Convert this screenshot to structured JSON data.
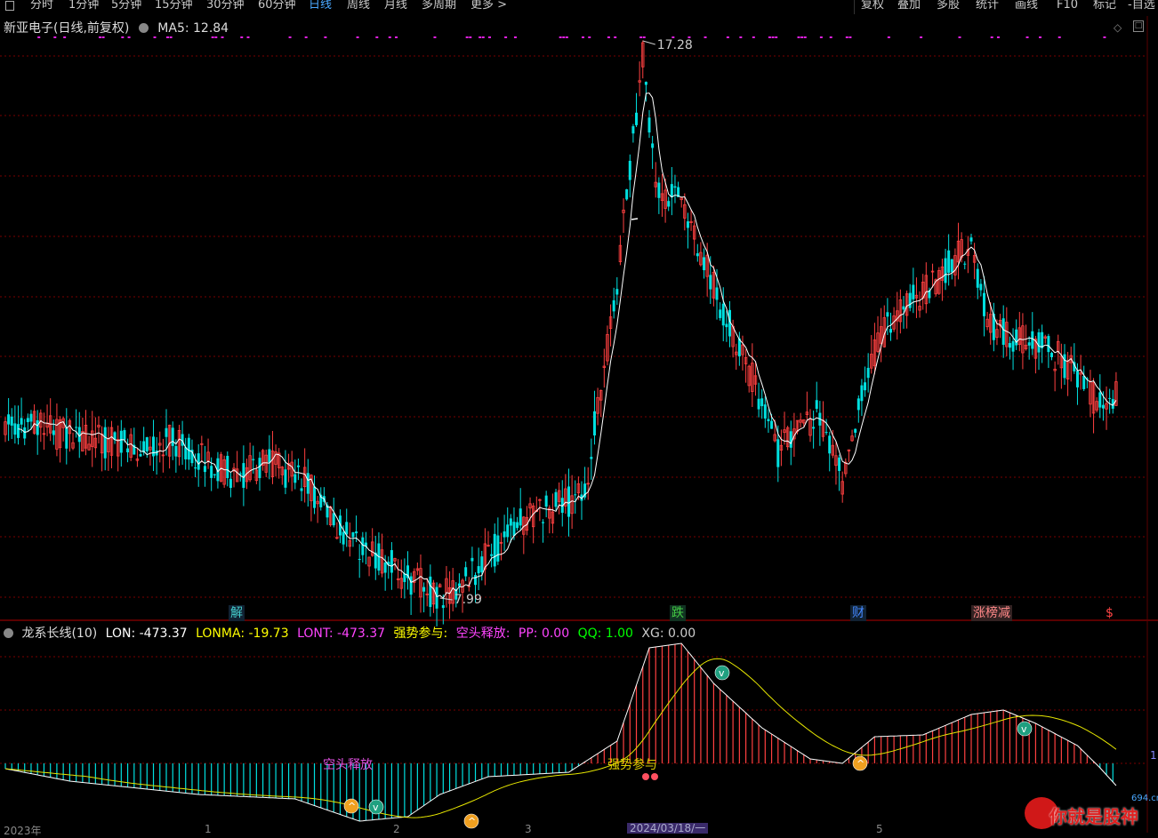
{
  "toolbar": {
    "left_tabs": [
      "分时",
      "1分钟",
      "5分钟",
      "15分钟",
      "30分钟",
      "60分钟",
      "日线",
      "周线",
      "月线",
      "多周期",
      "更多 >"
    ],
    "active_tab": "日线",
    "right_tabs": [
      "复权",
      "叠加",
      "多股",
      "统计",
      "画线",
      "F10",
      "标记",
      "-自选"
    ]
  },
  "stock": {
    "title": "新亚电子(日线,前复权)",
    "ma_label": "MA5: 12.84",
    "high_label": "17.28",
    "low_label": "7.99"
  },
  "events": [
    {
      "label": "解",
      "color": "#4cc",
      "bg": "#123"
    },
    {
      "label": "跌",
      "color": "#4c4",
      "bg": "#132"
    },
    {
      "label": "财",
      "color": "#48f",
      "bg": "#123"
    },
    {
      "label": "涨榜减",
      "color": "#f88",
      "bg": "#322"
    },
    {
      "label": "$",
      "color": "#f44",
      "bg": "transparent"
    }
  ],
  "indicator": {
    "name": "龙系长线(10)",
    "lon": "LON: -473.37",
    "lonma": "LONMA: -19.73",
    "lont": "LONT: -473.37",
    "strong_label": "强势参与:",
    "short_label": "空头释放:",
    "pp": "PP: 0.00",
    "qq": "QQ: 1.00",
    "xg": "XG: 0.00",
    "annot_short": "空头释放",
    "annot_strong": "强势参与",
    "right_tag": "1"
  },
  "axis": {
    "year_label": "2023年",
    "date_label": "2024/03/18/一",
    "tick_labels": [
      "1",
      "2",
      "3",
      "5"
    ]
  },
  "watermark": {
    "text": "你就是股神",
    "url": "694.cn"
  },
  "colors": {
    "up": "#ff4040",
    "down": "#00e0e0",
    "ma": "#ffffff",
    "lonma": "#e6e600",
    "grid": "#7a0000",
    "active_tab": "#4aa8ff",
    "lon_label": "#ffffff",
    "lonma_label": "#ffff00",
    "lont_label": "#ff44ff",
    "strong_label": "#ffff00",
    "short_label": "#ff44ff",
    "pp_label": "#ff44ff",
    "qq_label": "#00ff00",
    "xg_label": "#cccccc"
  },
  "chart_data": {
    "type": "candlestick",
    "price_high": 17.28,
    "price_low": 7.99,
    "ma_period": 5,
    "ma_last": 12.84,
    "indicator_last": {
      "LON": -473.37,
      "LONMA": -19.73,
      "LONT": -473.37,
      "PP": 0.0,
      "QQ": 1.0,
      "XG": 0.0
    }
  }
}
